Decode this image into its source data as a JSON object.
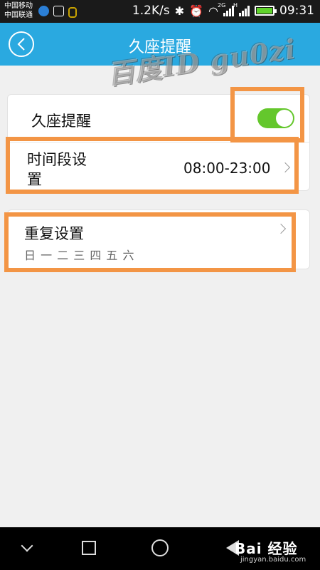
{
  "status_bar": {
    "carrier_1": "中国移动",
    "carrier_2": "中国联通",
    "net_speed": "1.2K/s",
    "sig_tag_1": "2G",
    "sig_tag_2": "H",
    "time": "09:31",
    "icons": [
      "app-icon",
      "image-icon",
      "lock-icon",
      "bluetooth-icon",
      "alarm-icon",
      "wifi-icon",
      "signal-icon",
      "battery-icon"
    ]
  },
  "header": {
    "title": "久座提醒",
    "back_icon": "chevron-left-icon"
  },
  "watermark": "百度ID gu0zi",
  "settings": {
    "sedentary_label": "久座提醒",
    "sedentary_enabled": true,
    "time_period_label_line1": "时间段设",
    "time_period_label_line2": "置",
    "time_period_value": "08:00-23:00",
    "repeat_label": "重复设置",
    "repeat_days": "日 一 二 三 四 五 六"
  },
  "nav_bar": {
    "items": [
      "back-icon",
      "home-icon",
      "recent-apps-icon",
      "menu-icon"
    ],
    "logo_text": "Bai 经验",
    "logo_url": "jingyan.baidu.com"
  },
  "colors": {
    "header": "#2aa9e0",
    "toggle_on": "#64c72c",
    "highlight": "#f39545"
  }
}
